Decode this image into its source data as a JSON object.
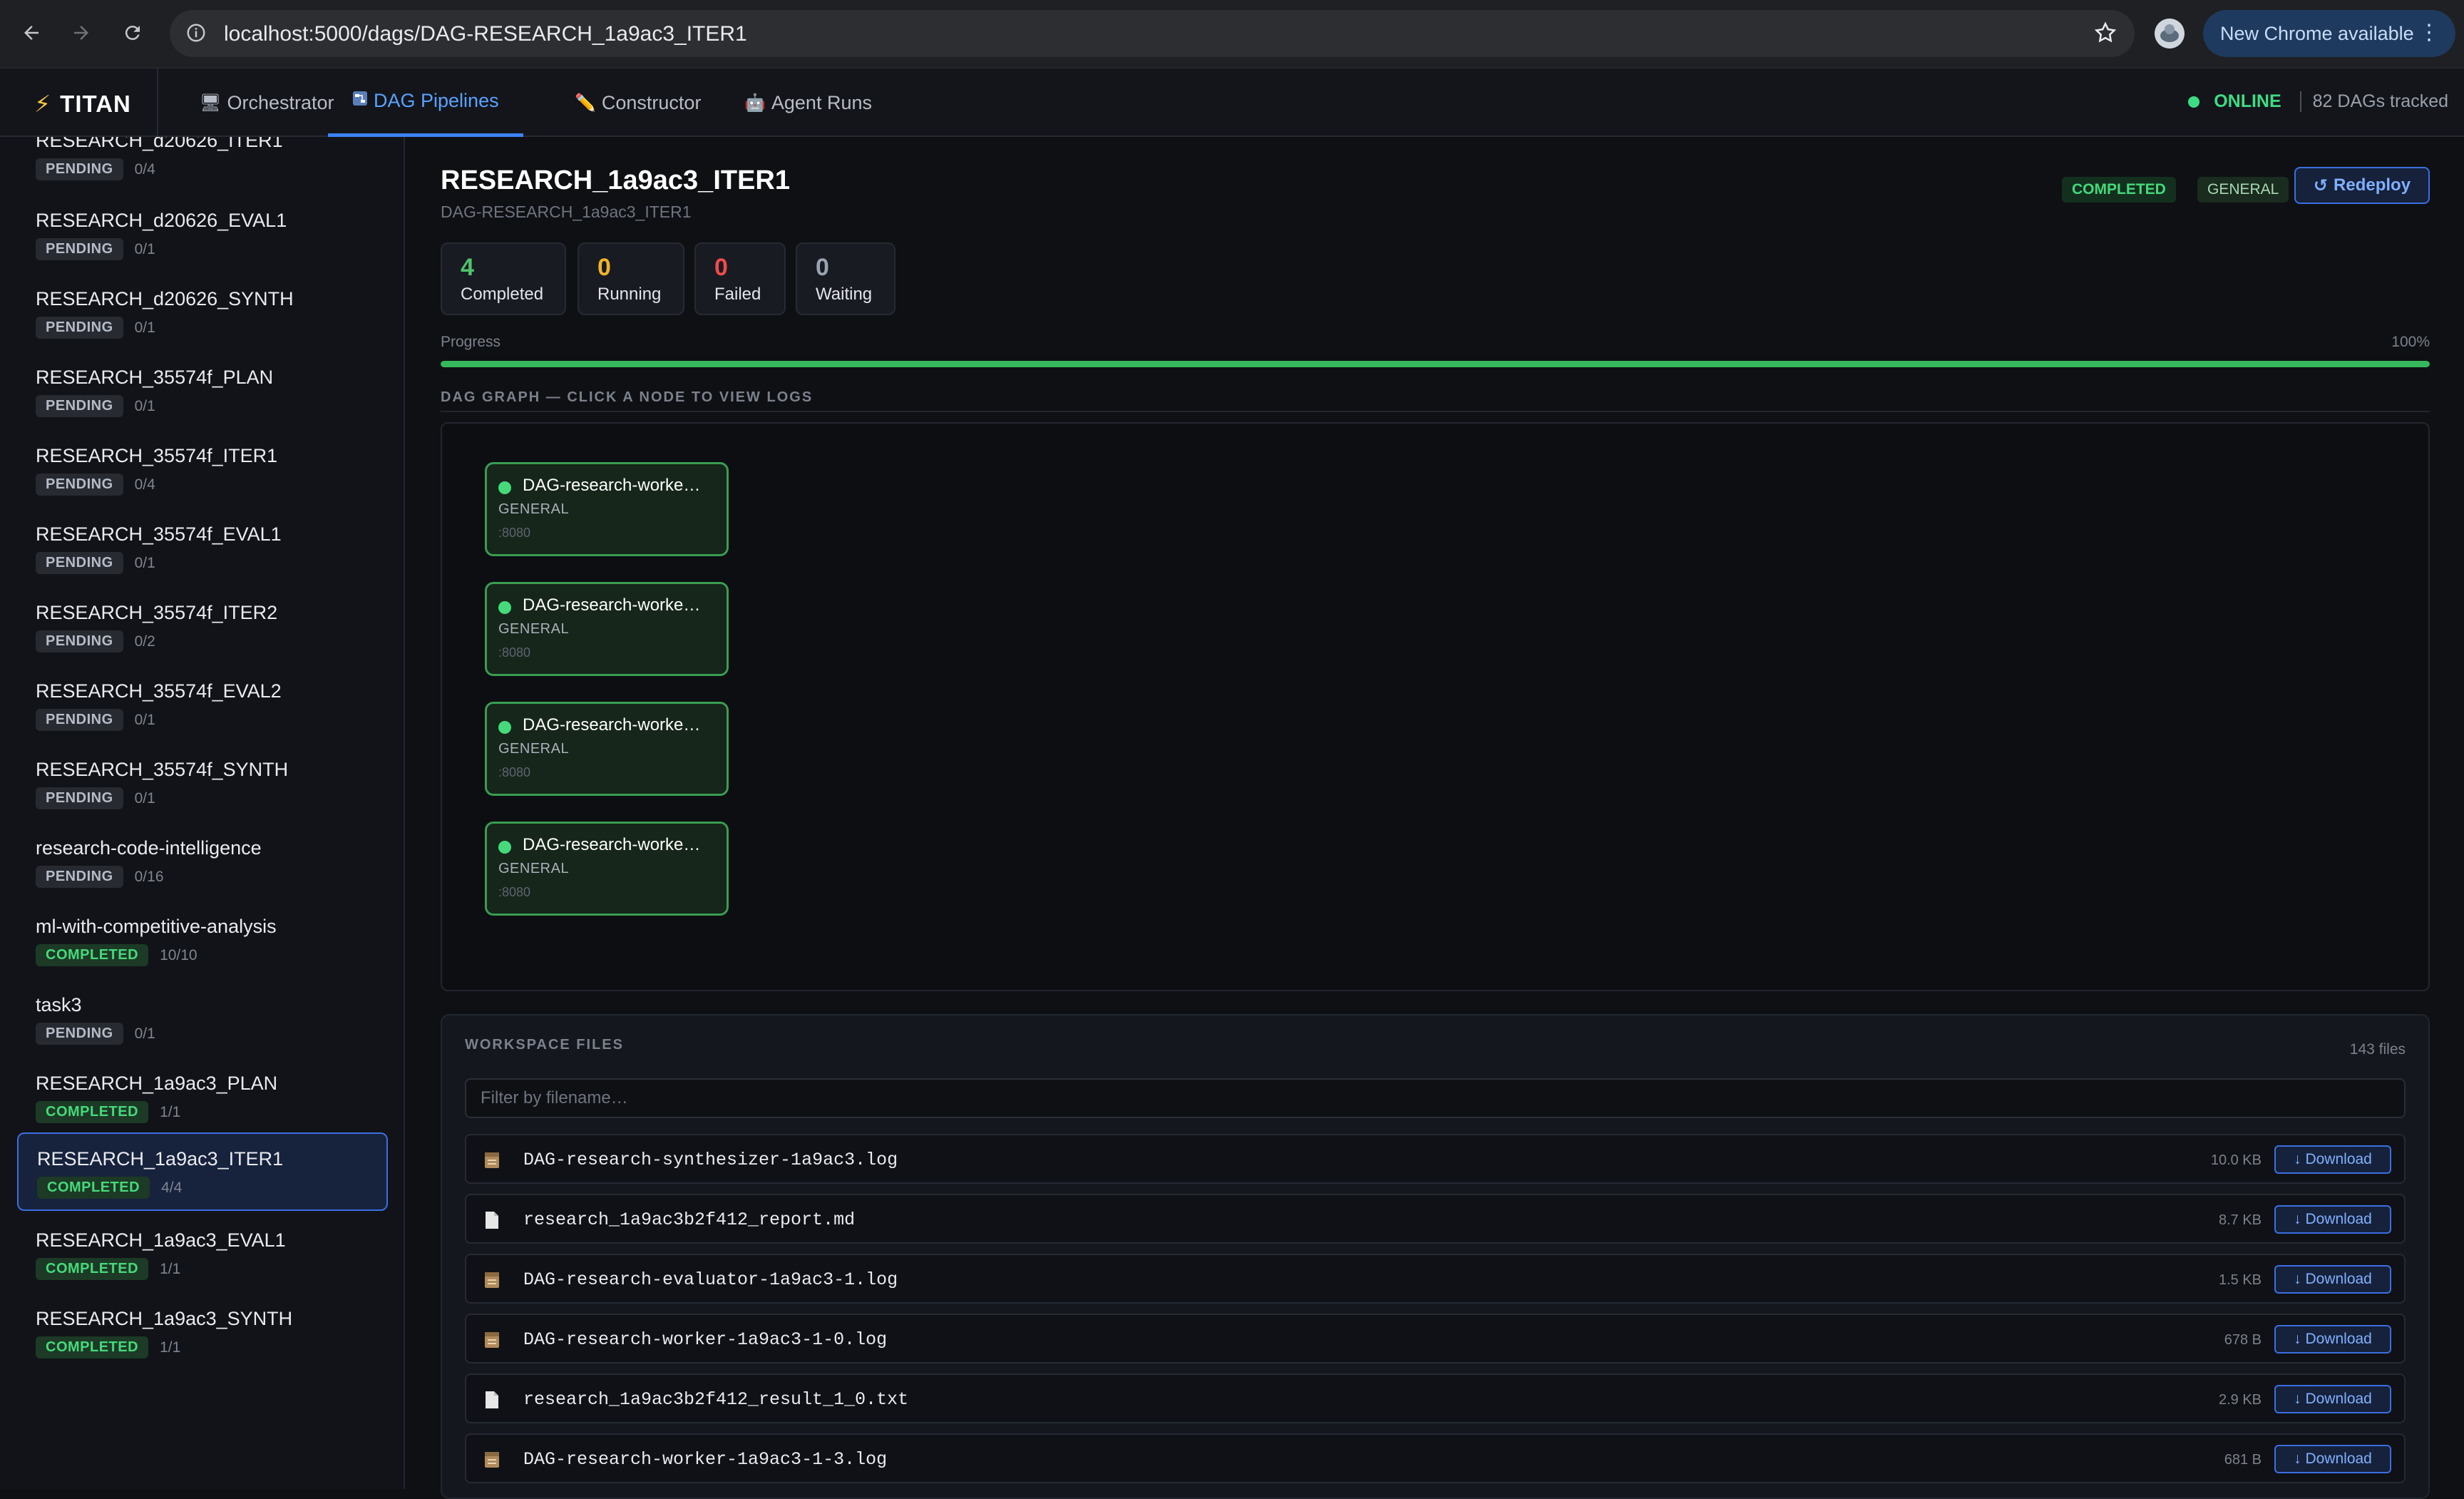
{
  "browser": {
    "url": "localhost:5000/dags/DAG-RESEARCH_1a9ac3_ITER1",
    "update_label": "New Chrome available"
  },
  "app": {
    "brand": "TITAN",
    "tabs": [
      {
        "label": "Orchestrator",
        "icon": "monitor-icon"
      },
      {
        "label": "DAG Pipelines",
        "icon": "pipeline-icon",
        "active": true
      },
      {
        "label": "Constructor",
        "icon": "pencil-icon"
      },
      {
        "label": "Agent Runs",
        "icon": "robot-icon"
      }
    ],
    "status": "ONLINE",
    "tracked": "82 DAGs tracked"
  },
  "sidebar": {
    "items": [
      {
        "name": "RESEARCH_d20626_ITER1",
        "status": "PENDING",
        "count": "0/4"
      },
      {
        "name": "RESEARCH_d20626_EVAL1",
        "status": "PENDING",
        "count": "0/1"
      },
      {
        "name": "RESEARCH_d20626_SYNTH",
        "status": "PENDING",
        "count": "0/1"
      },
      {
        "name": "RESEARCH_35574f_PLAN",
        "status": "PENDING",
        "count": "0/1"
      },
      {
        "name": "RESEARCH_35574f_ITER1",
        "status": "PENDING",
        "count": "0/4"
      },
      {
        "name": "RESEARCH_35574f_EVAL1",
        "status": "PENDING",
        "count": "0/1"
      },
      {
        "name": "RESEARCH_35574f_ITER2",
        "status": "PENDING",
        "count": "0/2"
      },
      {
        "name": "RESEARCH_35574f_EVAL2",
        "status": "PENDING",
        "count": "0/1"
      },
      {
        "name": "RESEARCH_35574f_SYNTH",
        "status": "PENDING",
        "count": "0/1"
      },
      {
        "name": "research-code-intelligence",
        "status": "PENDING",
        "count": "0/16"
      },
      {
        "name": "ml-with-competitive-analysis",
        "status": "COMPLETED",
        "count": "10/10"
      },
      {
        "name": "task3",
        "status": "PENDING",
        "count": "0/1"
      },
      {
        "name": "RESEARCH_1a9ac3_PLAN",
        "status": "COMPLETED",
        "count": "1/1"
      },
      {
        "name": "RESEARCH_1a9ac3_ITER1",
        "status": "COMPLETED",
        "count": "4/4",
        "selected": true
      },
      {
        "name": "RESEARCH_1a9ac3_EVAL1",
        "status": "COMPLETED",
        "count": "1/1"
      },
      {
        "name": "RESEARCH_1a9ac3_SYNTH",
        "status": "COMPLETED",
        "count": "1/1"
      }
    ]
  },
  "detail": {
    "title": "RESEARCH_1a9ac3_ITER1",
    "subtitle": "DAG-RESEARCH_1a9ac3_ITER1",
    "status_badge": "COMPLETED",
    "type_badge": "GENERAL",
    "redeploy_label": "Redeploy",
    "stats": [
      {
        "value": "4",
        "label": "Completed",
        "color": "#4fc36b"
      },
      {
        "value": "0",
        "label": "Running",
        "color": "#f0b429"
      },
      {
        "value": "0",
        "label": "Failed",
        "color": "#ef4b4b"
      },
      {
        "value": "0",
        "label": "Waiting",
        "color": "#9aa3b2"
      }
    ],
    "progress_label": "Progress",
    "progress_text": "100%",
    "progress_fraction": 1.0,
    "graph_heading": "DAG GRAPH — CLICK A NODE TO VIEW LOGS",
    "nodes": [
      {
        "name": "DAG-research-worke…",
        "type": "GENERAL",
        "port": ":8080"
      },
      {
        "name": "DAG-research-worke…",
        "type": "GENERAL",
        "port": ":8080"
      },
      {
        "name": "DAG-research-worke…",
        "type": "GENERAL",
        "port": ":8080"
      },
      {
        "name": "DAG-research-worke…",
        "type": "GENERAL",
        "port": ":8080"
      }
    ]
  },
  "files": {
    "heading": "WORKSPACE FILES",
    "count": "143 files",
    "filter_placeholder": "Filter by filename…",
    "download_label": "↓ Download",
    "rows": [
      {
        "name": "DAG-research-synthesizer-1a9ac3.log",
        "size": "10.0 KB",
        "icon": "log-file-icon"
      },
      {
        "name": "research_1a9ac3b2f412_report.md",
        "size": "8.7 KB",
        "icon": "document-icon"
      },
      {
        "name": "DAG-research-evaluator-1a9ac3-1.log",
        "size": "1.5 KB",
        "icon": "log-file-icon"
      },
      {
        "name": "DAG-research-worker-1a9ac3-1-0.log",
        "size": "678 B",
        "icon": "log-file-icon"
      },
      {
        "name": "research_1a9ac3b2f412_result_1_0.txt",
        "size": "2.9 KB",
        "icon": "document-icon"
      },
      {
        "name": "DAG-research-worker-1a9ac3-1-3.log",
        "size": "681 B",
        "icon": "log-file-icon"
      }
    ]
  }
}
